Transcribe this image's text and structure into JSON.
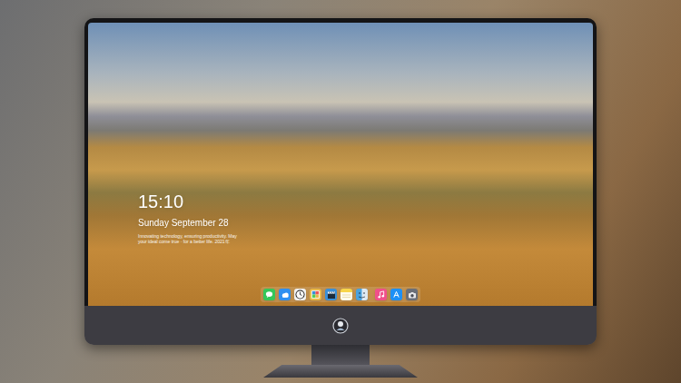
{
  "lock_screen": {
    "time": "15:10",
    "date": "Sunday September 28",
    "caption": "Innovating technology, ensuring productivity. May your ideal come true · for a better life. 2021年"
  },
  "dock": {
    "sections": [
      {
        "items": [
          {
            "kind": "messages",
            "color": "#34c759"
          },
          {
            "kind": "weather",
            "color": "#2f8ff0"
          },
          {
            "kind": "clock",
            "color": "#f2f2f2"
          },
          {
            "kind": "photos",
            "color": "#e9b949"
          },
          {
            "kind": "clapper",
            "color": "#3a8fd8"
          },
          {
            "kind": "notes",
            "color": "#f7d54a"
          },
          {
            "kind": "finder",
            "color": "#4aa3df"
          }
        ]
      },
      {
        "items": [
          {
            "kind": "music",
            "color": "#f0508a"
          },
          {
            "kind": "store",
            "color": "#1e90f5"
          },
          {
            "kind": "camera",
            "color": "#6b6f78"
          }
        ]
      }
    ]
  }
}
